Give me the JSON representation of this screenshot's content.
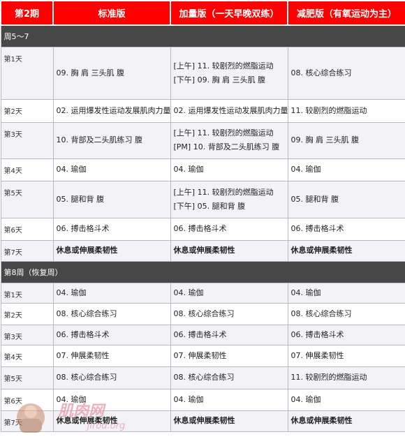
{
  "header": {
    "col0": "第2期",
    "col1": "标准版",
    "col2": "加量版（一天早晚双练）",
    "col3": "减肥版（有氧运动为主）"
  },
  "sections": [
    {
      "title": "周5～7",
      "rows": [
        {
          "day": "第1天",
          "c1": [
            "09. 胸  肩  三头肌  腹"
          ],
          "c2": [
            "[上午] 11. 较剧烈的燃脂运动",
            "[下午] 09. 胸  肩  三头肌  腹"
          ],
          "c3": [
            "08. 核心综合练习"
          ]
        },
        {
          "day": "第2天",
          "c1": [
            "02. 运用爆发性运动发展肌肉力量"
          ],
          "c2": [
            "02. 运用爆发性运动发展肌肉力量"
          ],
          "c3": [
            "11. 较剧烈的燃脂运动"
          ]
        },
        {
          "day": "第3天",
          "c1": [
            "10. 背部及二头肌练习  腹"
          ],
          "c2": [
            "[上午] 11. 较剧烈的燃脂运动",
            "[PM]  10. 背部及二头肌练习  腹"
          ],
          "c3": [
            "09. 胸  肩  三头肌  腹"
          ]
        },
        {
          "day": "第4天",
          "c1": [
            "04. 瑜伽"
          ],
          "c2": [
            "04. 瑜伽"
          ],
          "c3": [
            "04. 瑜伽"
          ]
        },
        {
          "day": "第5天",
          "c1": [
            "05. 腿和背  腹"
          ],
          "c2": [
            "[上午] 11. 较剧烈的燃脂运动",
            "[下午] 05. 腿和背  腹"
          ],
          "c3": [
            "05. 腿和背  腹"
          ]
        },
        {
          "day": "第6天",
          "c1": [
            "06. 搏击格斗术"
          ],
          "c2": [
            "06. 搏击格斗术"
          ],
          "c3": [
            "06. 搏击格斗术"
          ]
        },
        {
          "day": "第7天",
          "c1": [
            "休息或伸展柔韧性"
          ],
          "c2": [
            "休息或伸展柔韧性"
          ],
          "c3": [
            "休息或伸展柔韧性"
          ],
          "bold": true
        }
      ]
    },
    {
      "title": "第8周（恢复周）",
      "rows": [
        {
          "day": "第1天",
          "c1": [
            "04. 瑜伽"
          ],
          "c2": [
            "04. 瑜伽"
          ],
          "c3": [
            "04. 瑜伽"
          ]
        },
        {
          "day": "第2天",
          "c1": [
            "08. 核心综合练习"
          ],
          "c2": [
            "08. 核心综合练习"
          ],
          "c3": [
            "08. 核心综合练习"
          ]
        },
        {
          "day": "第3天",
          "c1": [
            "06. 搏击格斗术"
          ],
          "c2": [
            "06. 搏击格斗术"
          ],
          "c3": [
            "06. 搏击格斗术"
          ]
        },
        {
          "day": "第4天",
          "c1": [
            "07. 伸展柔韧性"
          ],
          "c2": [
            "07. 伸展柔韧性"
          ],
          "c3": [
            "07. 伸展柔韧性"
          ]
        },
        {
          "day": "第5天",
          "c1": [
            "08. 核心综合练习"
          ],
          "c2": [
            "08. 核心综合练习"
          ],
          "c3": [
            "11. 较剧烈的燃脂运动"
          ]
        },
        {
          "day": "第6天",
          "c1": [
            "04. 瑜伽"
          ],
          "c2": [
            "04. 瑜伽"
          ],
          "c3": [
            "04. 瑜伽"
          ]
        },
        {
          "day": "第7天",
          "c1": [
            "休息或伸展柔韧性"
          ],
          "c2": [
            "休息或伸展柔韧性"
          ],
          "c3": [
            "休息或伸展柔韧性"
          ],
          "bold": true
        }
      ]
    }
  ],
  "watermark": {
    "text": "肌肉网",
    "subtext": "jirou.org",
    "color": "#e8a0b0"
  }
}
